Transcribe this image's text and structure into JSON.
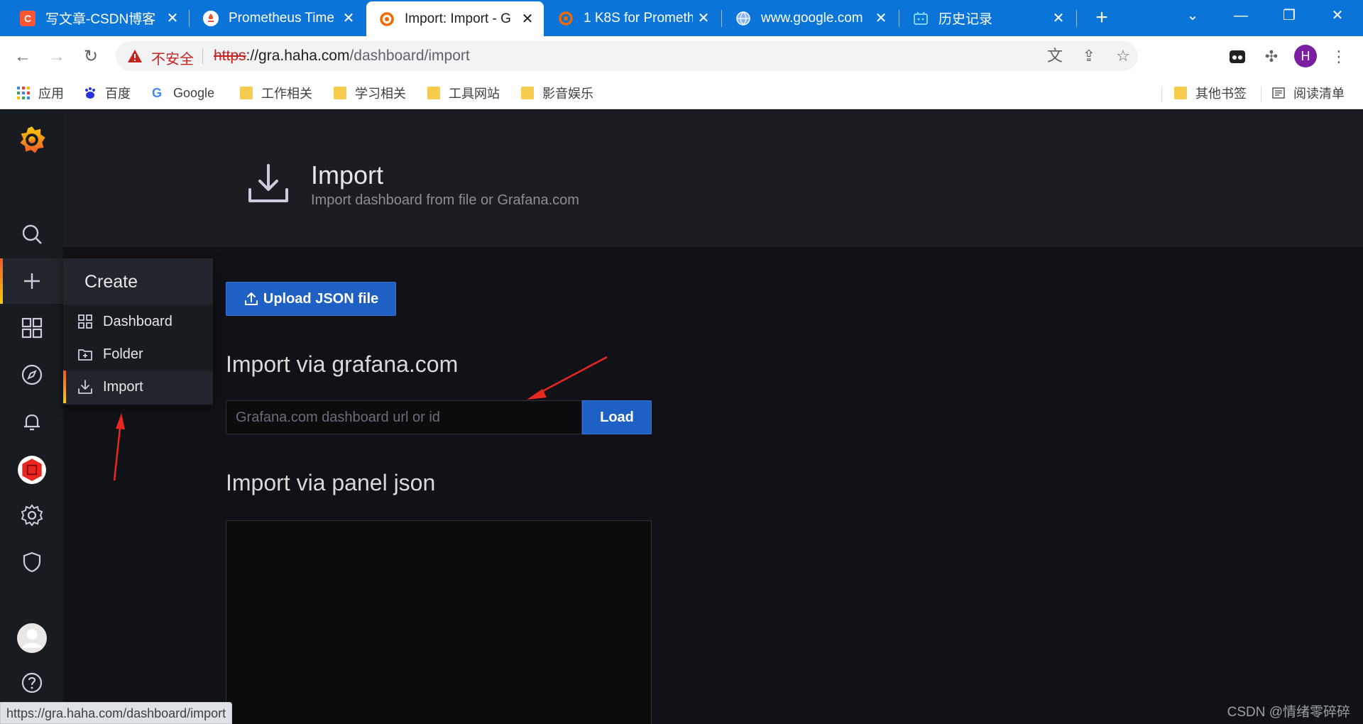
{
  "browser": {
    "tabs": [
      {
        "title": "写文章-CSDN博客",
        "favicon": "csdn-icon",
        "active": false
      },
      {
        "title": "Prometheus Time",
        "favicon": "prometheus-icon",
        "active": false
      },
      {
        "title": "Import: Import - G",
        "favicon": "grafana-icon",
        "active": true
      },
      {
        "title": "1 K8S for Prometh",
        "favicon": "grafana-icon",
        "active": false
      },
      {
        "title": "www.google.com",
        "favicon": "globe-icon",
        "active": false
      },
      {
        "title": "历史记录",
        "favicon": "history-icon",
        "active": false
      }
    ],
    "address": {
      "security_label": "不安全",
      "scheme": "https",
      "host": "://gra.haha.com",
      "path": "/dashboard/import"
    },
    "profile_initial": "H",
    "bookmarks": [
      {
        "label": "应用",
        "icon": "apps-grid-icon"
      },
      {
        "label": "百度",
        "icon": "baidu-icon"
      },
      {
        "label": "Google",
        "icon": "google-icon"
      },
      {
        "label": "工作相关",
        "icon": "folder-icon"
      },
      {
        "label": "学习相关",
        "icon": "folder-icon"
      },
      {
        "label": "工具网站",
        "icon": "folder-icon"
      },
      {
        "label": "影音娱乐",
        "icon": "folder-icon"
      }
    ],
    "other_bookmarks": "其他书签",
    "reading_list": "阅读清单",
    "status_url": "https://gra.haha.com/dashboard/import"
  },
  "grafana": {
    "header": {
      "title": "Import",
      "subtitle": "Import dashboard from file or Grafana.com"
    },
    "upload_button": "Upload JSON file",
    "grafana_com_section": "Import via grafana.com",
    "url_input_placeholder": "Grafana.com dashboard url or id",
    "load_button": "Load",
    "panel_json_section": "Import via panel json",
    "create_menu": {
      "title": "Create",
      "items": [
        {
          "label": "Dashboard",
          "icon": "dashboard-grid-icon"
        },
        {
          "label": "Folder",
          "icon": "folder-plus-icon"
        },
        {
          "label": "Import",
          "icon": "import-icon"
        }
      ]
    }
  },
  "watermark": "CSDN @情绪零碎碎",
  "colors": {
    "chrome_blue": "#0a74d9",
    "grafana_bg": "#111217",
    "primary_button": "#1f60c4",
    "annotation_arrow": "#e8271e"
  }
}
